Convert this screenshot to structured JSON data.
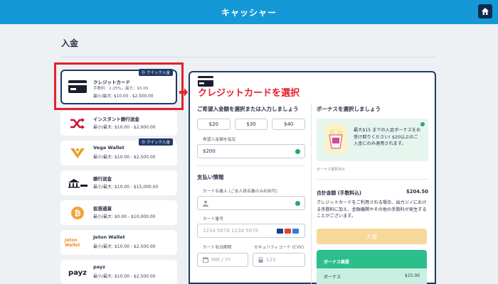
{
  "header": {
    "title": "キャッシャー",
    "home_icon": "home-icon"
  },
  "page": {
    "section_title": "入金"
  },
  "annotation": {
    "text": "クレジットカードを選択",
    "color": "#e3212b"
  },
  "selected_method": {
    "name": "クレジットカード",
    "fee": "手数料：2.25%，最大：$5.00",
    "limit": "最小/最大: $10.00 - $2,500.00",
    "badge": "⓪ クイック入金"
  },
  "methods": [
    {
      "name": "インスタント銀行送金",
      "limit": "最小/最大: $10.00 - $2,000.00",
      "icon": "shuffle-icon"
    },
    {
      "name": "Vega Wallet",
      "limit": "最小/最大: $10.00 - $2,500.00",
      "icon": "vega-icon",
      "badge": "⓪ クイック入金"
    },
    {
      "name": "銀行送金",
      "limit": "最小/最大: $10.00 - $15,000.00",
      "icon": "bank-icon"
    },
    {
      "name": "仮想通貨",
      "limit": "最小/最大: $0.00 - $10,000.00",
      "icon": "bitcoin-icon"
    },
    {
      "name": "Jeton Wallet",
      "limit": "最小/最大: $10.00 - $2,500.00",
      "icon": "jeton-icon",
      "logo_text": "Jeton Wallet"
    },
    {
      "name": "payz",
      "limit": "最小/最大: $10.00 - $2,500.00",
      "icon": "payz-icon",
      "logo_text": "payz"
    }
  ],
  "deposit": {
    "amount_heading": "ご希望入金額を選択または入力しましょう",
    "amounts": [
      "$20",
      "$30",
      "$40"
    ],
    "amount_label": "希望入金額を指定",
    "amount_value": "$200",
    "payment_heading": "支払い情報",
    "holder_label": "カード名義人 (ご本人様名義のみ利用可)",
    "holder_value": "",
    "number_label": "カード番号",
    "number_placeholder": "1234 5678 1234 5678",
    "expiry_label": "カード有効期限",
    "expiry_placeholder": "MM / YY",
    "cvv_label": "セキュリティコード (CVV)",
    "cvv_placeholder": "123"
  },
  "bonus": {
    "heading": "ボーナスを選択しましょう",
    "text": "最大$15 までの入金ボーナスをお受け取りください! $20以上のご入金にのみ適用されます。",
    "note": "ボーナス選択済み"
  },
  "summary": {
    "total_label": "合計金額 (手数料込)",
    "total_value": "$204.50",
    "note": "クレジットカードをご利用される場合、出力ジノにおける手数料に加え、金融機関やその他の手数料が発生することがございます。",
    "submit_label": "入金",
    "bonus_summary_title": "ボーナス概要",
    "bonus_row_label": "ボーナス",
    "bonus_row_value": "$15.00"
  },
  "colors": {
    "header": "#1499d6",
    "accent_dark": "#1f3a64",
    "success": "#2aa66a",
    "submit": "#f6d89b",
    "summary": "#2cbf8c"
  }
}
